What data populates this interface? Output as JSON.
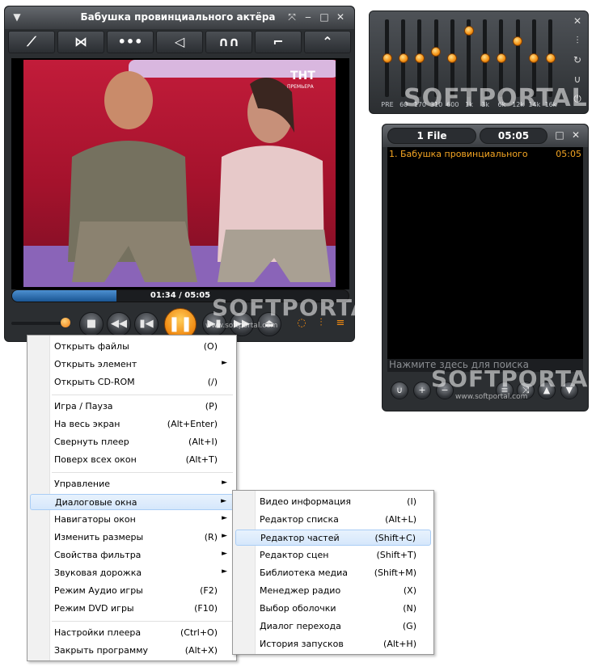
{
  "player": {
    "title": "Бабушка провинциального актёра",
    "time": "01:34 / 05:05",
    "progress": 0.31,
    "mode_icons": [
      "curve-icon",
      "shuttle-icon",
      "dots-icon",
      "send-icon",
      "wave-icon",
      "step-icon",
      "peak-icon"
    ],
    "tv_logo": "ТНТ",
    "tv_logo_sub": "ПРЕМЬЕРА"
  },
  "watermark": {
    "text": "SOFTPORTAL",
    "sub": "www.softportal.com"
  },
  "equalizer": {
    "labels": [
      "PRE",
      "60",
      "170",
      "310",
      "600",
      "1k",
      "3k",
      "6k",
      "12k",
      "14k",
      "16k"
    ],
    "levels": [
      0.5,
      0.5,
      0.5,
      0.6,
      0.5,
      0.9,
      0.5,
      0.5,
      0.75,
      0.5,
      0.5
    ]
  },
  "playlist": {
    "count": "1 File",
    "total": "05:05",
    "items": [
      {
        "title": "1. Бабушка провинциального",
        "duration": "05:05"
      }
    ],
    "search_placeholder": "Нажмите здесь для поиска"
  },
  "menu_main": [
    {
      "label": "Открыть файлы",
      "key": "(O)"
    },
    {
      "label": "Открыть элемент",
      "arrow": "►"
    },
    {
      "label": "Открыть CD-ROM",
      "key": "(/)"
    },
    {
      "label": "Игра / Пауза",
      "key": "(P)"
    },
    {
      "label": "На весь экран",
      "key": "(Alt+Enter)"
    },
    {
      "label": "Свернуть плеер",
      "key": "(Alt+I)"
    },
    {
      "label": "Поверх всех окон",
      "key": "(Alt+T)"
    },
    {
      "label": "Управление",
      "arrow": "►"
    },
    {
      "label": "Диалоговые окна",
      "arrow": "►"
    },
    {
      "label": "Навигаторы окон",
      "arrow": "►"
    },
    {
      "label": "Изменить размеры",
      "key": "(R)",
      "arrow": "►"
    },
    {
      "label": "Свойства фильтра",
      "arrow": "►"
    },
    {
      "label": "Звуковая дорожка",
      "arrow": "►"
    },
    {
      "label": "Режим Аудио игры",
      "key": "(F2)"
    },
    {
      "label": "Режим DVD игры",
      "key": "(F10)"
    },
    {
      "label": "Настройки плеера",
      "key": "(Ctrl+O)"
    },
    {
      "label": "Закрыть программу",
      "key": "(Alt+X)"
    }
  ],
  "menu_sub": [
    {
      "label": "Видео информация",
      "key": "(I)"
    },
    {
      "label": "Редактор списка",
      "key": "(Alt+L)"
    },
    {
      "label": "Редактор частей",
      "key": "(Shift+C)"
    },
    {
      "label": "Редактор сцен",
      "key": "(Shift+T)"
    },
    {
      "label": "Библиотека медиа",
      "key": "(Shift+M)"
    },
    {
      "label": "Менеджер радио",
      "key": "(X)"
    },
    {
      "label": "Выбор оболочки",
      "key": "(N)"
    },
    {
      "label": "Диалог перехода",
      "key": "(G)"
    },
    {
      "label": "История запусков",
      "key": "(Alt+H)"
    }
  ],
  "colors": {
    "accent": "#f08a12",
    "highlight": "#d5e7fb",
    "playlist_text": "#f5a623"
  }
}
